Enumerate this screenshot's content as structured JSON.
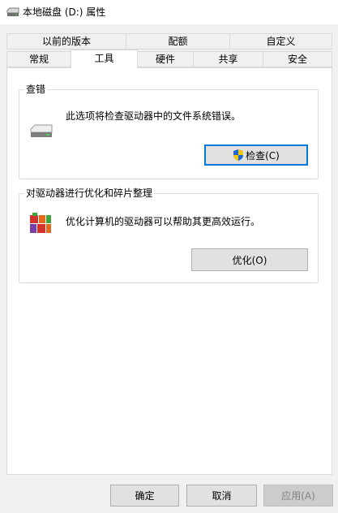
{
  "window": {
    "title": "本地磁盘 (D:) 属性"
  },
  "tabs": {
    "row_top": [
      {
        "label": "以前的版本"
      },
      {
        "label": "配额"
      },
      {
        "label": "自定义"
      }
    ],
    "row_bottom": [
      {
        "label": "常规"
      },
      {
        "label": "工具"
      },
      {
        "label": "硬件"
      },
      {
        "label": "共享"
      },
      {
        "label": "安全"
      }
    ],
    "active": "工具"
  },
  "error_check": {
    "title": "查错",
    "description": "此选项将检查驱动器中的文件系统错误。",
    "button_label": "检查(C)"
  },
  "optimize": {
    "title": "对驱动器进行优化和碎片整理",
    "description": "优化计算机的驱动器可以帮助其更高效运行。",
    "button_label": "优化(O)"
  },
  "footer": {
    "ok_label": "确定",
    "cancel_label": "取消",
    "apply_label": "应用(A)"
  },
  "colors": {
    "focus_border": "#0078d7",
    "button_face": "#e1e1e1",
    "panel_bg": "#ffffff",
    "window_bg": "#f0f0f0"
  },
  "icons": {
    "title": "drive-icon",
    "error_check": "hard-drive-icon",
    "optimize": "defrag-icon",
    "check_button": "uac-shield-icon"
  }
}
